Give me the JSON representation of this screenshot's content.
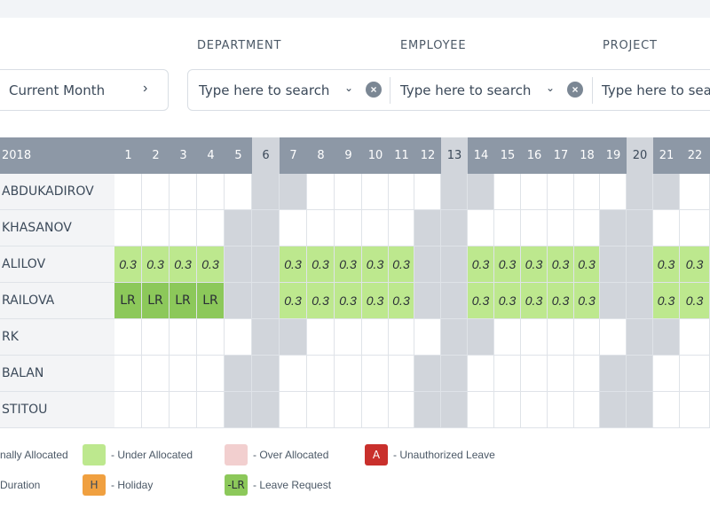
{
  "filters": {
    "department_label": "DEPARTMENT",
    "employee_label": "EMPLOYEE",
    "project_label": "PROJECT",
    "month_value": "Current Month",
    "department_placeholder": "Type here to search",
    "employee_placeholder": "Type here to search",
    "project_placeholder": "Type here to search"
  },
  "grid": {
    "year_label": "2018",
    "days": [
      "1",
      "2",
      "3",
      "4",
      "5",
      "6",
      "7",
      "8",
      "9",
      "10",
      "11",
      "12",
      "13",
      "14",
      "15",
      "16",
      "17",
      "18",
      "19",
      "20",
      "21",
      "22"
    ],
    "weekend_days": [
      6,
      13,
      20
    ],
    "employees": [
      {
        "name": "ABDUKADIROV",
        "cells": [
          "",
          "",
          "",
          "",
          "",
          "",
          "",
          "",
          "",
          "",
          "",
          "",
          "",
          "",
          "",
          "",
          "",
          "",
          "",
          "",
          "",
          ""
        ]
      },
      {
        "name": "KHASANOV",
        "cells": [
          "",
          "",
          "",
          "",
          "",
          "",
          "",
          "",
          "",
          "",
          "",
          "",
          "",
          "",
          "",
          "",
          "",
          "",
          "",
          "",
          "",
          ""
        ]
      },
      {
        "name": "ALILOV",
        "cells": [
          "0.3",
          "0.3",
          "0.3",
          "0.3",
          "",
          "",
          "0.3",
          "0.3",
          "0.3",
          "0.3",
          "0.3",
          "",
          "",
          "0.3",
          "0.3",
          "0.3",
          "0.3",
          "0.3",
          "",
          "",
          "0.3",
          "0.3"
        ]
      },
      {
        "name": "RAILOVA",
        "cells": [
          "LR",
          "LR",
          "LR",
          "LR",
          "",
          "",
          "0.3",
          "0.3",
          "0.3",
          "0.3",
          "0.3",
          "",
          "",
          "0.3",
          "0.3",
          "0.3",
          "0.3",
          "0.3",
          "",
          "",
          "0.3",
          "0.3"
        ]
      },
      {
        "name": "RK",
        "cells": [
          "",
          "",
          "",
          "",
          "",
          "",
          "",
          "",
          "",
          "",
          "",
          "",
          "",
          "",
          "",
          "",
          "",
          "",
          "",
          "",
          "",
          ""
        ]
      },
      {
        "name": "BALAN",
        "cells": [
          "",
          "",
          "",
          "",
          "",
          "",
          "",
          "",
          "",
          "",
          "",
          "",
          "",
          "",
          "",
          "",
          "",
          "",
          "",
          "",
          "",
          ""
        ]
      },
      {
        "name": "STITOU",
        "cells": [
          "",
          "",
          "",
          "",
          "",
          "",
          "",
          "",
          "",
          "",
          "",
          "",
          "",
          "",
          "",
          "",
          "",
          "",
          "",
          "",
          "",
          ""
        ]
      }
    ]
  },
  "legend": {
    "normally_allocated": "nally Allocated",
    "under_allocated": "- Under Allocated",
    "over_allocated": "- Over Allocated",
    "unauthorized_leave": "- Unauthorized Leave",
    "unauthorized_symbol": "A",
    "duration": "Duration",
    "holiday": "- Holiday",
    "holiday_symbol": "H",
    "leave_request": "- Leave Request",
    "leave_request_symbol": "-LR",
    "colors": {
      "under_allocated": "#bde88e",
      "over_allocated": "#f2cfcf",
      "unauthorized": "#c9302c",
      "holiday": "#f0a040",
      "leave_request": "#8cc85a"
    }
  }
}
